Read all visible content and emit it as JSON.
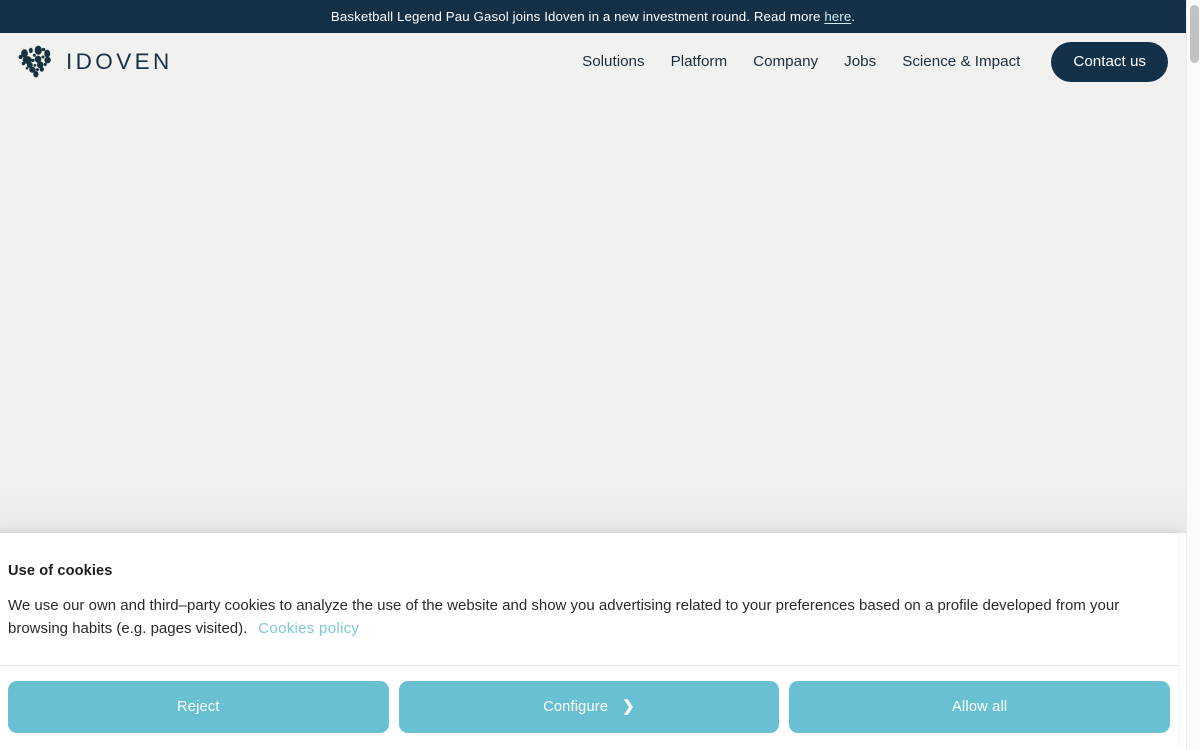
{
  "announcement": {
    "text_before": "Basketball Legend Pau Gasol joins Idoven in a new investment round. Read more ",
    "link_label": "here",
    "text_after": ".",
    "background_color": "#133047"
  },
  "header": {
    "logo_icon": "heart-dots-logo-icon",
    "brand_name": "IDOVEN",
    "brand_color": "#1a3246",
    "nav_items": [
      {
        "label": "Solutions"
      },
      {
        "label": "Platform"
      },
      {
        "label": "Company"
      },
      {
        "label": "Jobs"
      },
      {
        "label": "Science & Impact"
      }
    ],
    "cta": {
      "label": "Contact us",
      "background_color": "#13324a",
      "text_color": "#ffffff"
    }
  },
  "cookie_banner": {
    "title": "Use of cookies",
    "description": "We use our own and third–party cookies to analyze the use of the website and show you advertising related to your preferences based on a profile developed from your browsing habits (e.g. pages visited).",
    "policy_link_label": "Cookies policy",
    "policy_link_color": "#7ec6dd",
    "button_color": "#68c0d2",
    "buttons": [
      {
        "label": "Reject",
        "icon": null
      },
      {
        "label": "Configure",
        "icon": "chevron-right-icon"
      },
      {
        "label": "Allow all",
        "icon": null
      }
    ]
  },
  "scrollbar": {
    "orientation": "vertical",
    "thumb_color": "#c2c2c2"
  }
}
